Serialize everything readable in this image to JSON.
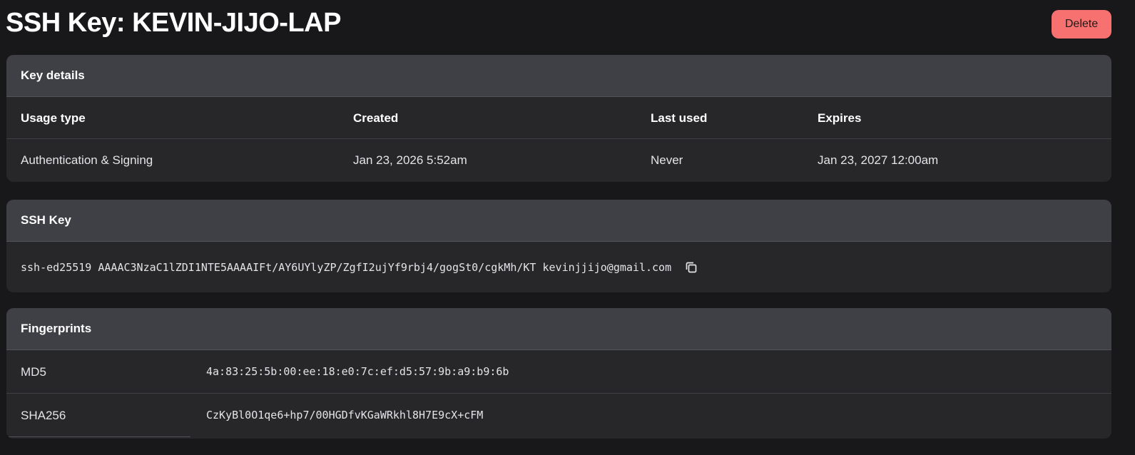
{
  "page": {
    "title": "SSH Key: KEVIN-JIJO-LAP",
    "delete_label": "Delete"
  },
  "details": {
    "header": "Key details",
    "columns": [
      "Usage type",
      "Created",
      "Last used",
      "Expires"
    ],
    "values": [
      "Authentication & Signing",
      "Jan 23, 2026 5:52am",
      "Never",
      "Jan 23, 2027 12:00am"
    ]
  },
  "ssh_key": {
    "header": "SSH Key",
    "value": "ssh-ed25519 AAAAC3NzaC1lZDI1NTE5AAAAIFt/AY6UYlyZP/ZgfI2ujYf9rbj4/gogSt0/cgkMh/KT kevinjjijo@gmail.com",
    "copy_icon": "copy-icon"
  },
  "fingerprints": {
    "header": "Fingerprints",
    "rows": [
      {
        "label": "MD5",
        "value": "4a:83:25:5b:00:ee:18:e0:7c:ef:d5:57:9b:a9:b9:6b"
      },
      {
        "label": "SHA256",
        "value": "CzKyBl0O1qe6+hp7/00HGDfvKGaWRkhl8H7E9cX+cFM"
      }
    ]
  },
  "colors": {
    "background": "#18181b",
    "card": "#27272a",
    "card_header": "#3f3f46",
    "danger": "#f87171"
  }
}
